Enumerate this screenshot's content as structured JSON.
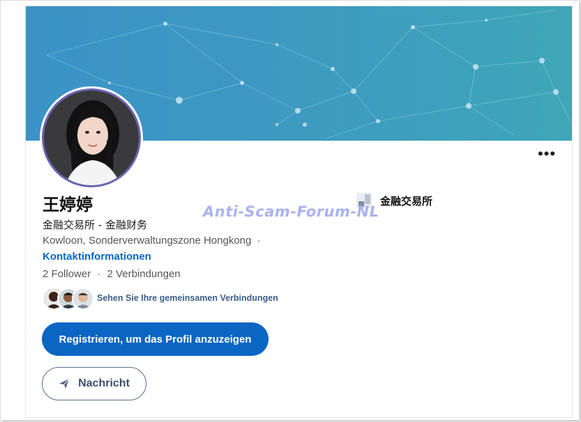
{
  "profile": {
    "name": "王婷婷",
    "headline": "金融交易所 - 金融财务",
    "location": "Kowloon, Sonderverwaltungszone Hongkong",
    "location_sep": "·",
    "contact_link": "Kontaktinformationen",
    "followers": "2 Follower",
    "stats_sep": "·",
    "connections": "2 Verbindungen",
    "mutual_link": "Sehen Sie Ihre gemeinsamen Verbindungen"
  },
  "company": {
    "name": "金融交易所",
    "logo_icon": "company-logo-icon"
  },
  "watermark": "Anti-Scam-Forum-NL",
  "actions": {
    "register_label": "Registrieren, um das Profil anzuzeigen",
    "message_label": "Nachricht",
    "more_label": "•••"
  },
  "colors": {
    "accent": "#0a66c2",
    "banner": "#3d9ac0",
    "avatar_ring": "#6b63b5",
    "watermark": "#a9b3ef"
  }
}
